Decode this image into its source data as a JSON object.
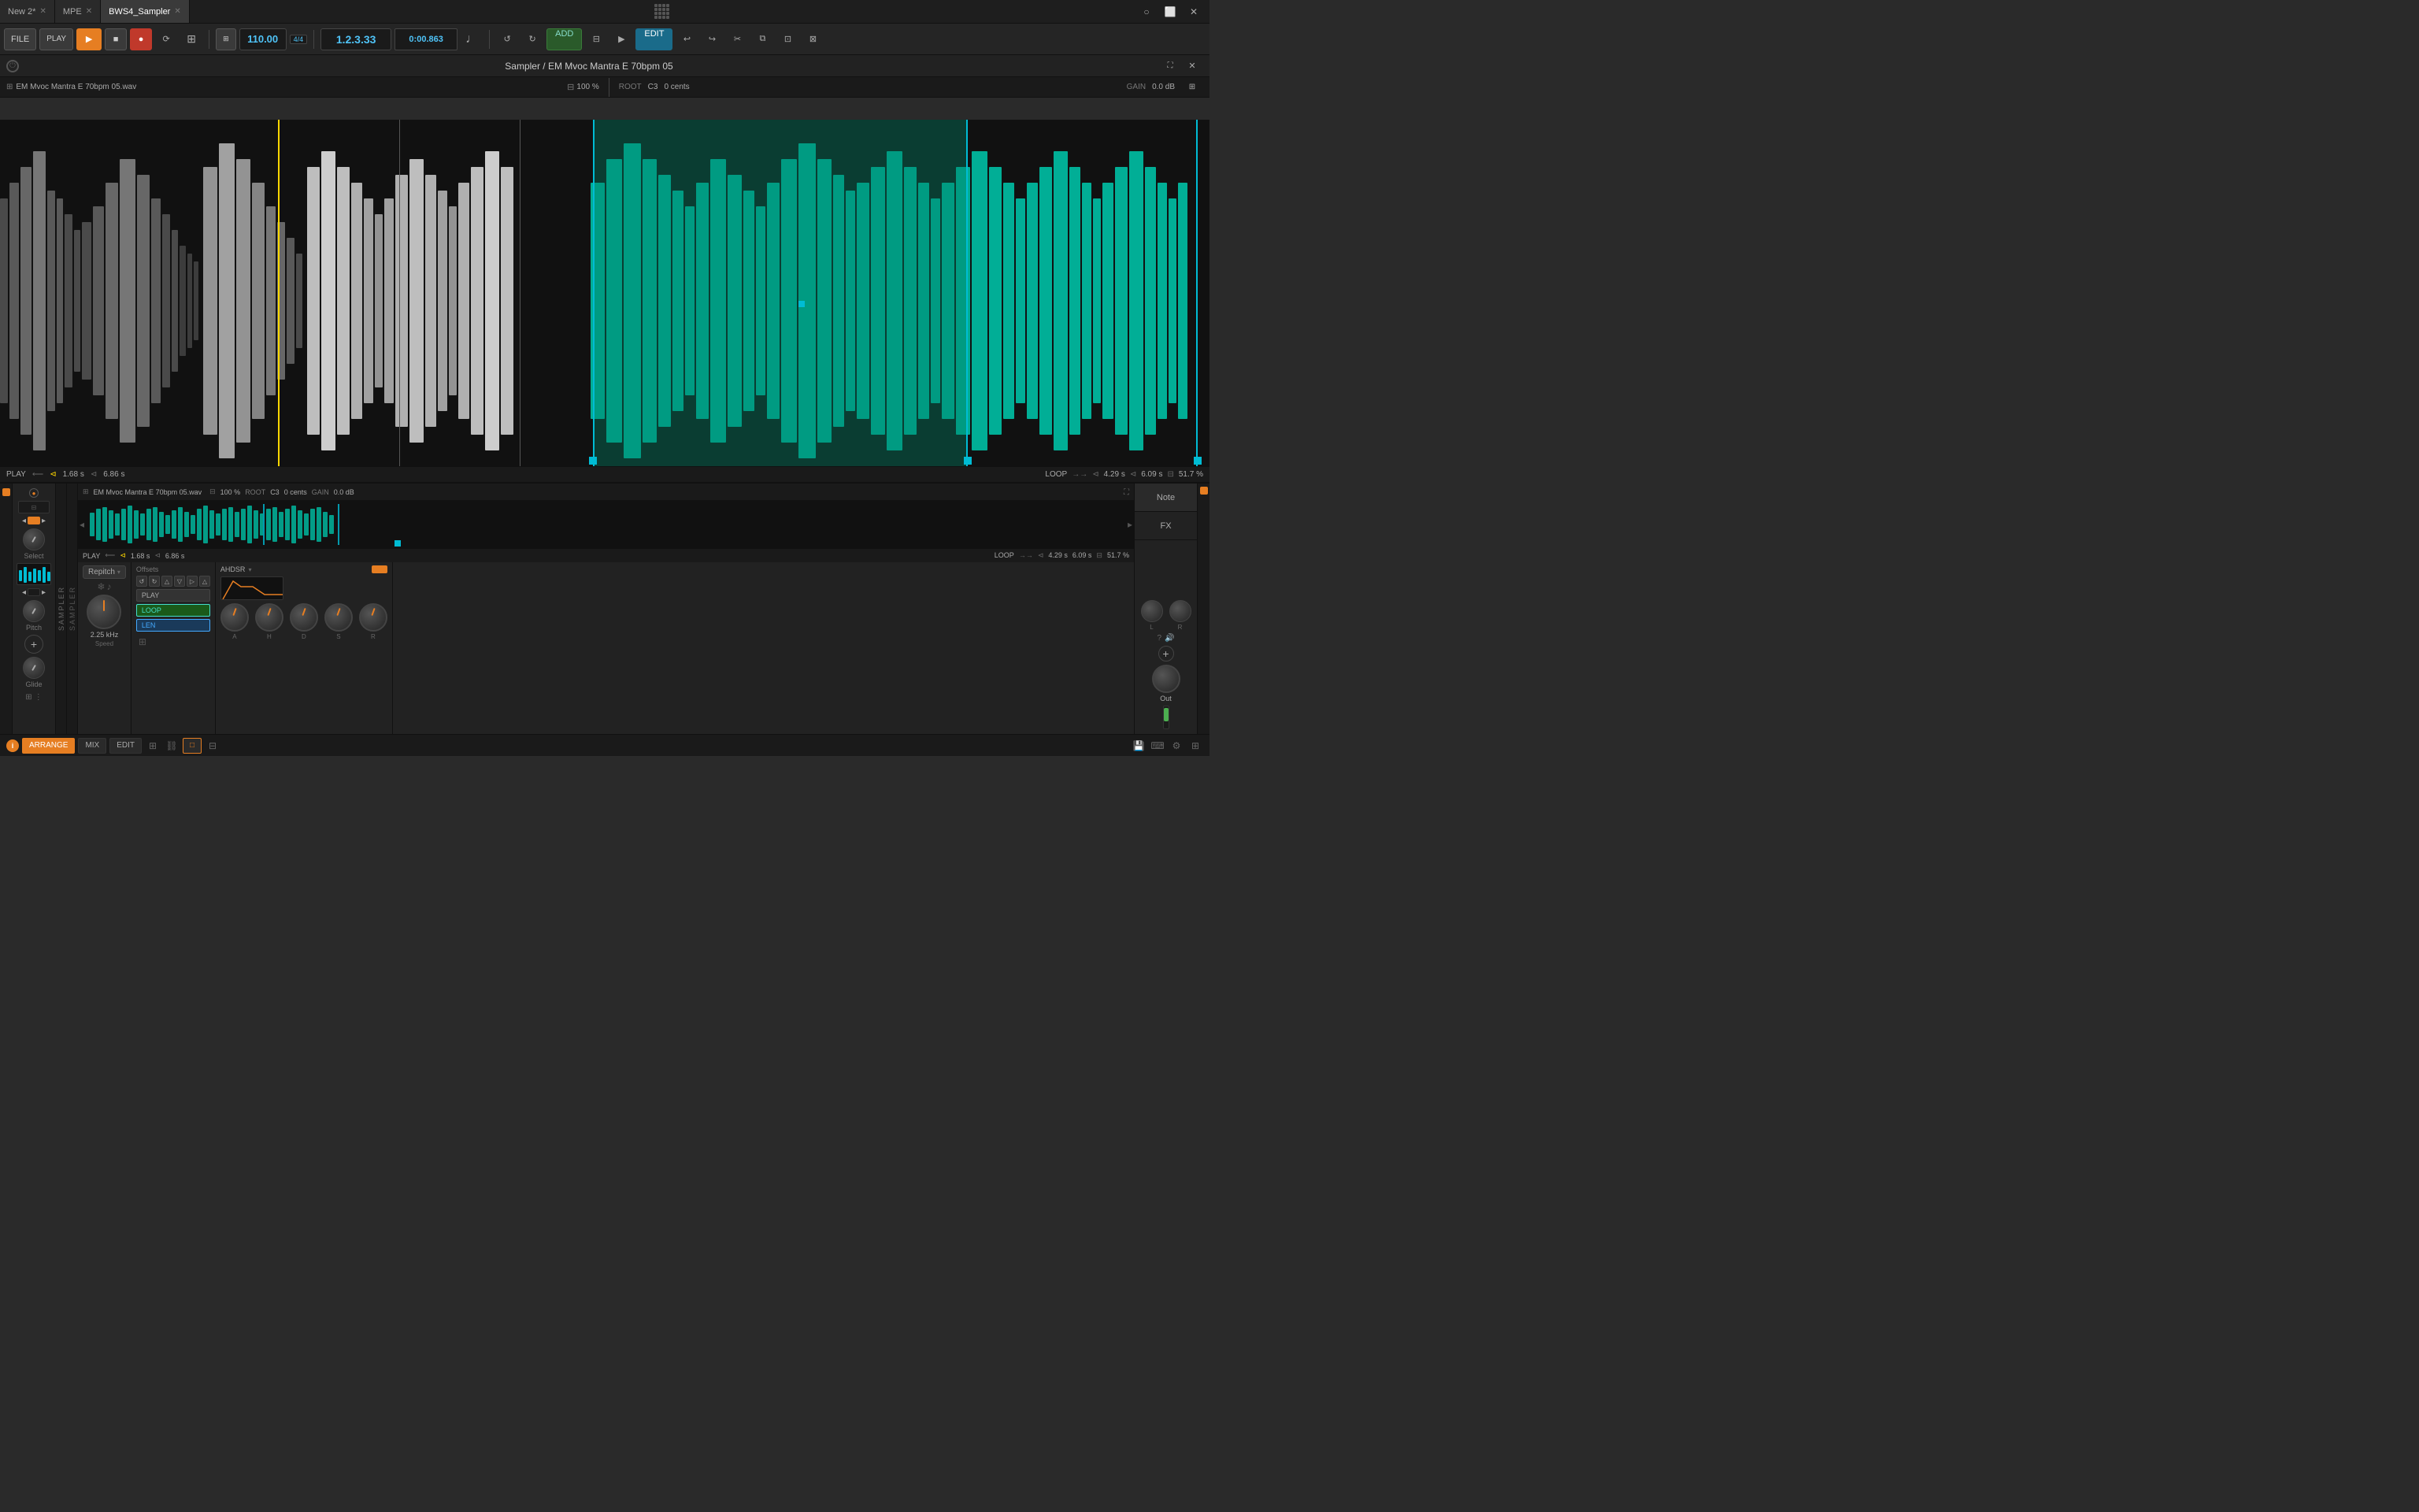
{
  "tabs": [
    {
      "label": "New 2*",
      "active": false,
      "closeable": true
    },
    {
      "label": "MPE",
      "active": false,
      "closeable": true
    },
    {
      "label": "BWS4_Sampler",
      "active": true,
      "closeable": true
    }
  ],
  "transport": {
    "file_label": "FILE",
    "play_label": "PLAY",
    "bpm": "110.00",
    "time_sig": "4/4",
    "position": "1.2.3.33",
    "position2": "0:00.863",
    "add_label": "ADD",
    "edit_label": "EDIT"
  },
  "sampler": {
    "title": "Sampler / EM Mvoc Mantra E 70bpm 05",
    "file_name": "EM Mvoc Mantra E 70bpm 05.wav",
    "zoom": "100 %",
    "root": "C3",
    "tune": "0 cents",
    "gain": "0.0 dB",
    "play_pos": "1.68 s",
    "loop_start": "6.86 s",
    "loop_label": "LOOP",
    "loop_len": "4.29 s",
    "loop_end": "6.09 s",
    "loop_pct": "51.7 %"
  },
  "bottom_panel": {
    "file_name": "EM Mvoc Mantra E 70bpm 05.wav",
    "zoom": "100 %",
    "root": "C3",
    "tune": "0 cents",
    "gain": "0.0 dB",
    "play_label": "PLAY",
    "play_pos": "1.68 s",
    "loop_start": "6.86 s",
    "loop_label": "LOOP",
    "loop_len": "4.29 s",
    "loop_end": "6.09 s",
    "loop_pct": "51.7 %",
    "repitch_label": "Repitch",
    "offsets_label": "Offsets",
    "play_mode_label": "PLAY",
    "loop_mode_label": "LOOP",
    "len_mode_label": "LEN",
    "speed_label": "Speed",
    "speed_val": "2.25 kHz",
    "ahdsr_label": "AHDSR",
    "env_labels": [
      "A",
      "H",
      "D",
      "S",
      "R"
    ],
    "out_label": "Out",
    "note_label": "Note",
    "fx_label": "FX"
  },
  "footer": {
    "arrange_label": "ARRANGE",
    "mix_label": "MIX",
    "edit_label": "EDIT",
    "info_label": "i"
  },
  "left_panel": {
    "sampler_label": "SAMPLER",
    "select_label": "Select",
    "pitch_label": "Pitch",
    "glide_label": "Glide"
  }
}
